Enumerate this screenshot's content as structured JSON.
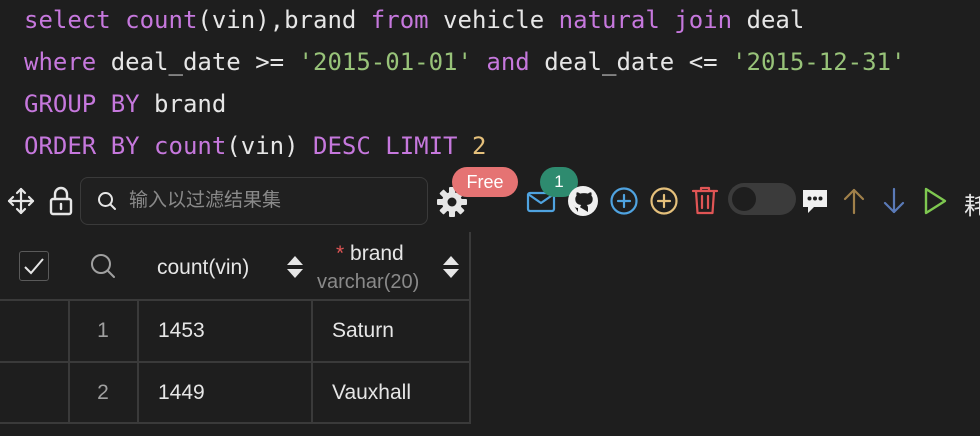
{
  "editor": {
    "line1": {
      "kw1": "select",
      "fn1": "count",
      "p1": "(vin),brand ",
      "kw2": "from",
      "p2": " vehicle ",
      "kw3": "natural",
      "p3": " ",
      "kw4": "join",
      "p4": " deal"
    },
    "line2": {
      "kw1": "where",
      "p1": " deal_date >= ",
      "s1": "'2015-01-01'",
      "p2": " ",
      "kw2": "and",
      "p3": " deal_date <= ",
      "s2": "'2015-12-31'"
    },
    "line3": {
      "kw1": "GROUP BY",
      "p1": " brand"
    },
    "line4": {
      "kw1": "ORDER BY",
      "p0": " ",
      "fn1": "count",
      "p1": "(vin) ",
      "kw2": "DESC LIMIT",
      "p2": " ",
      "n1": "2"
    }
  },
  "toolbar": {
    "search_placeholder": "输入以过滤结果集",
    "free_badge": "Free",
    "notification_count": "1",
    "more_label": "耗",
    "icons": [
      "move-icon",
      "lock-icon",
      "search-icon",
      "gear-icon",
      "mail-icon",
      "github-icon",
      "add-circle-icon",
      "add-circle-yellow-icon",
      "trash-icon",
      "toggle",
      "comment-icon",
      "arrow-up-icon",
      "arrow-down-icon",
      "run-icon"
    ],
    "colors": {
      "free": "#e57373",
      "badge": "#2e8b6f",
      "blue": "#4fa3e0",
      "yellow": "#e5c07b",
      "red": "#e05555",
      "green": "#7ec850",
      "brown": "#a0804a",
      "navy": "#5a7ab8"
    }
  },
  "grid": {
    "columns": [
      {
        "name": "count(vin)",
        "type": ""
      },
      {
        "name": "brand",
        "type": "varchar(20)",
        "required_mark": "*"
      }
    ],
    "rows": [
      {
        "num": "1",
        "cells": [
          "1453",
          "Saturn"
        ]
      },
      {
        "num": "2",
        "cells": [
          "1449",
          "Vauxhall"
        ]
      }
    ]
  }
}
